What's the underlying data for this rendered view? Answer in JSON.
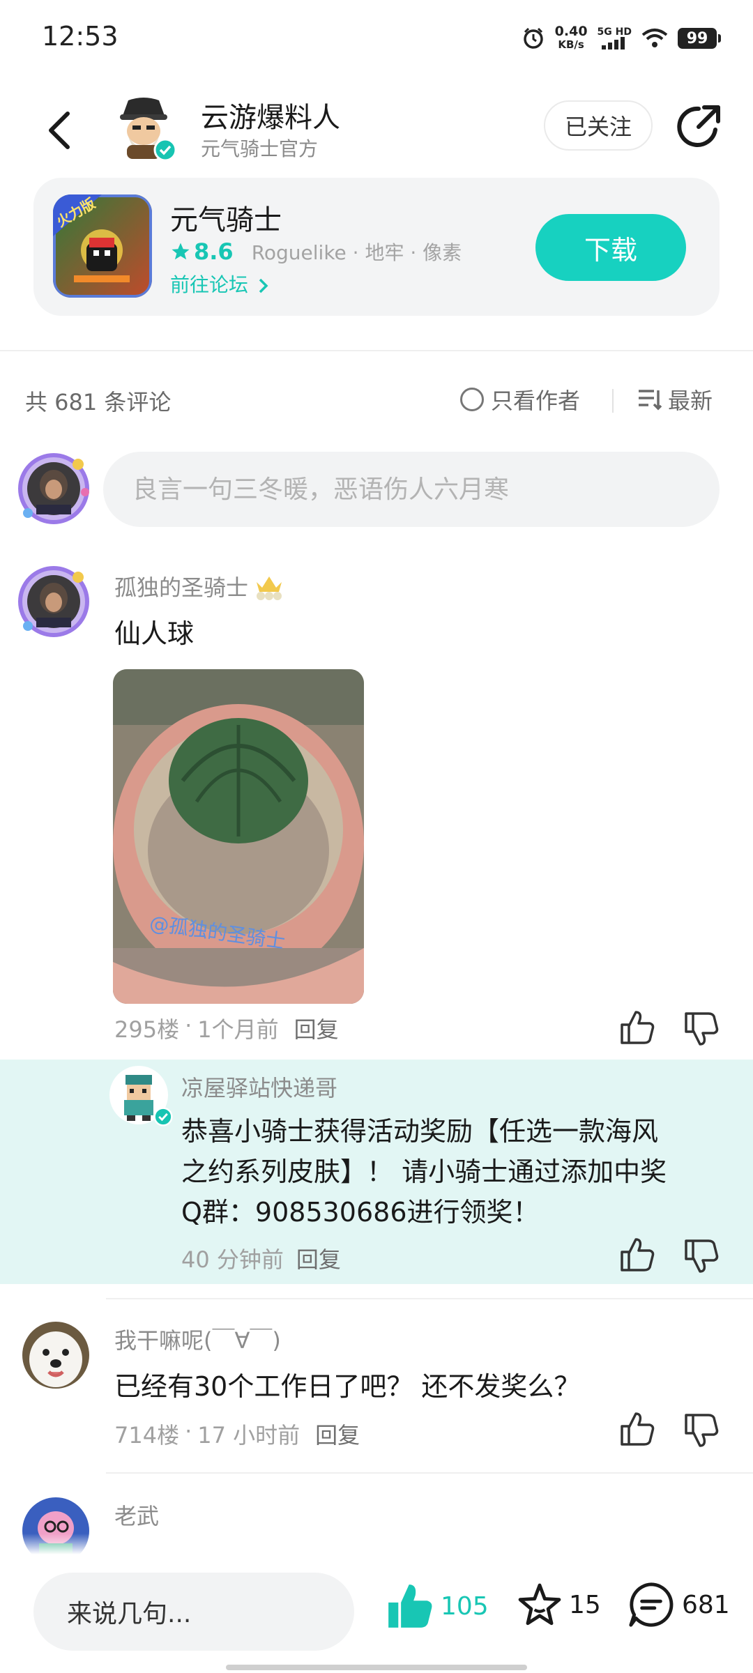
{
  "status": {
    "time": "12:53",
    "speed_value": "0.40",
    "speed_unit": "KB/s",
    "network": "5G HD",
    "battery": "99"
  },
  "header": {
    "author_name": "云游爆料人",
    "author_sub": "元气骑士官方",
    "follow_label": "已关注"
  },
  "game": {
    "name": "元气骑士",
    "rating": "8.6",
    "tags": "Roguelike · 地牢 · 像素",
    "forum_link": "前往论坛",
    "download_label": "下载",
    "icon_badge": "火力版"
  },
  "comments_bar": {
    "count_text": "共 681 条评论",
    "only_author": "只看作者",
    "sort_label": "最新"
  },
  "input": {
    "placeholder": "良言一句三冬暖，恶语伤人六月寒"
  },
  "comments": [
    {
      "name": "孤独的圣骑士",
      "body": "仙人球",
      "floor": "295楼",
      "time": "1个月前",
      "reply": "回复",
      "image_watermark": "@孤独的圣骑士"
    },
    {
      "name": "我干嘛呢(￣∀￣)",
      "body": "已经有30个工作日了吧？ 还不发奖么？",
      "floor": "714楼",
      "time": "17 小时前",
      "reply": "回复"
    },
    {
      "name": "老武"
    }
  ],
  "reply": {
    "name": "凉屋驿站快递哥",
    "body_line1": "恭喜小骑士获得活动奖励【任选一款海风",
    "body_line2": "之约系列皮肤】！ 请小骑士通过添加中奖",
    "body_line3": "Q群：908530686进行领奖！",
    "time": "40 分钟前",
    "reply": "回复"
  },
  "bottom": {
    "input_placeholder": "来说几句...",
    "likes": "105",
    "favorites": "15",
    "comments": "681"
  },
  "colors": {
    "accent": "#17d1c0",
    "reply_bg": "#e2f6f4"
  }
}
